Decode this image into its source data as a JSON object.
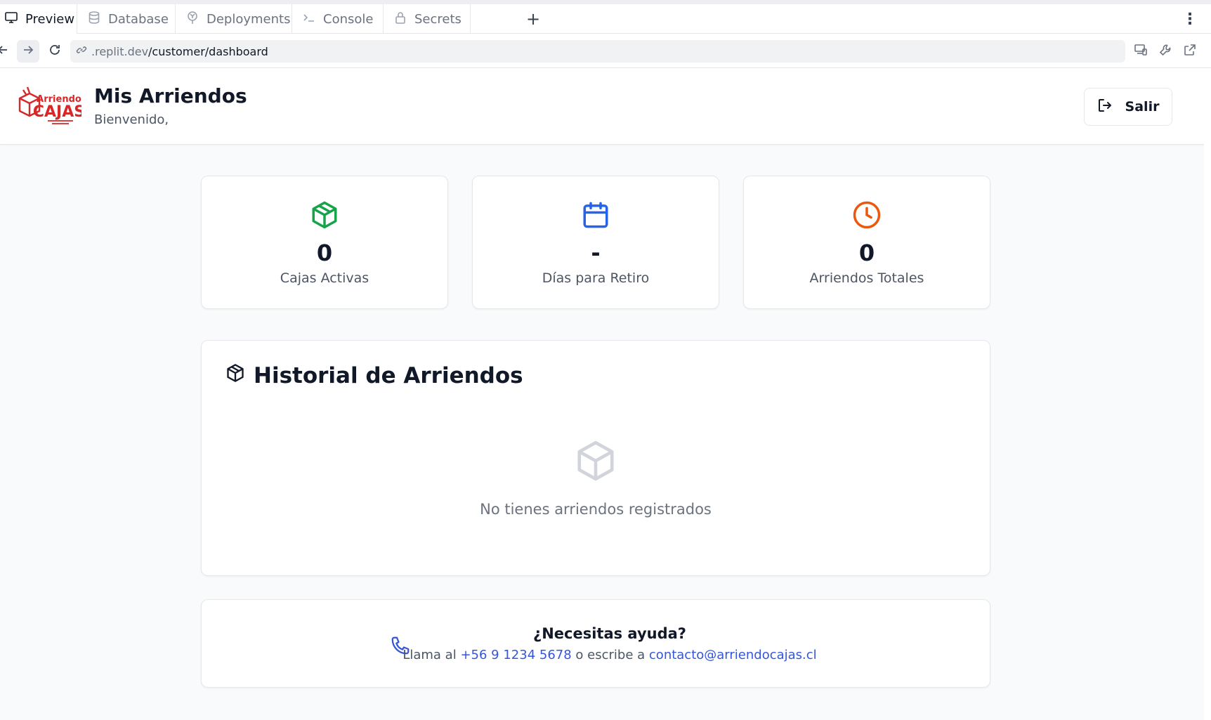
{
  "browser": {
    "tabs": [
      {
        "label": "Preview",
        "icon": "monitor-icon",
        "active": true
      },
      {
        "label": "Database",
        "icon": "database-icon",
        "active": false
      },
      {
        "label": "Deployments",
        "icon": "deployments-icon",
        "active": false
      },
      {
        "label": "Console",
        "icon": "terminal-icon",
        "active": false
      },
      {
        "label": "Secrets",
        "icon": "lock-icon",
        "active": false
      }
    ],
    "new_tab_label": "+",
    "menu_label": "⋮",
    "url_host": ".replit.dev",
    "url_path": "/customer/dashboard"
  },
  "header": {
    "logo_text_top": "Arriendo",
    "logo_text_bottom": "CAJAS",
    "title": "Mis Arriendos",
    "welcome": "Bienvenido,",
    "logout_label": "Salir"
  },
  "stats": [
    {
      "value": "0",
      "label": "Cajas Activas",
      "icon": "package-icon",
      "color": "#16a34a"
    },
    {
      "value": "-",
      "label": "Días para Retiro",
      "icon": "calendar-icon",
      "color": "#2563eb"
    },
    {
      "value": "0",
      "label": "Arriendos Totales",
      "icon": "clock-icon",
      "color": "#ea580c"
    }
  ],
  "history": {
    "title": "Historial de Arriendos",
    "empty_text": "No tienes arriendos registrados"
  },
  "help": {
    "title": "¿Necesitas ayuda?",
    "prefix": "Llama al",
    "phone": "+56 9 1234 5678",
    "middle": "o escribe a",
    "email": "contacto@arriendocajas.cl"
  },
  "colors": {
    "accent_link": "#3556d8",
    "brand_red": "#d62828"
  }
}
